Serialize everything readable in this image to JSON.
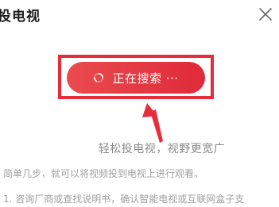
{
  "header": {
    "title": "投电视",
    "close_icon": "close-icon"
  },
  "search_button": {
    "label": "正在搜索 ···",
    "icon": "spinner-icon",
    "color": "#e23a44"
  },
  "annotation": {
    "highlight_color": "#e52d3b",
    "arrow_icon": "arrow-up-icon"
  },
  "content": {
    "tagline": "轻松投电视，视野更宽广",
    "intro": "简单几步，就可以将视频投到电视上进行观看。",
    "step1": "1. 咨询厂商或查找说明书，确认智能电视或互联网盒子支"
  }
}
